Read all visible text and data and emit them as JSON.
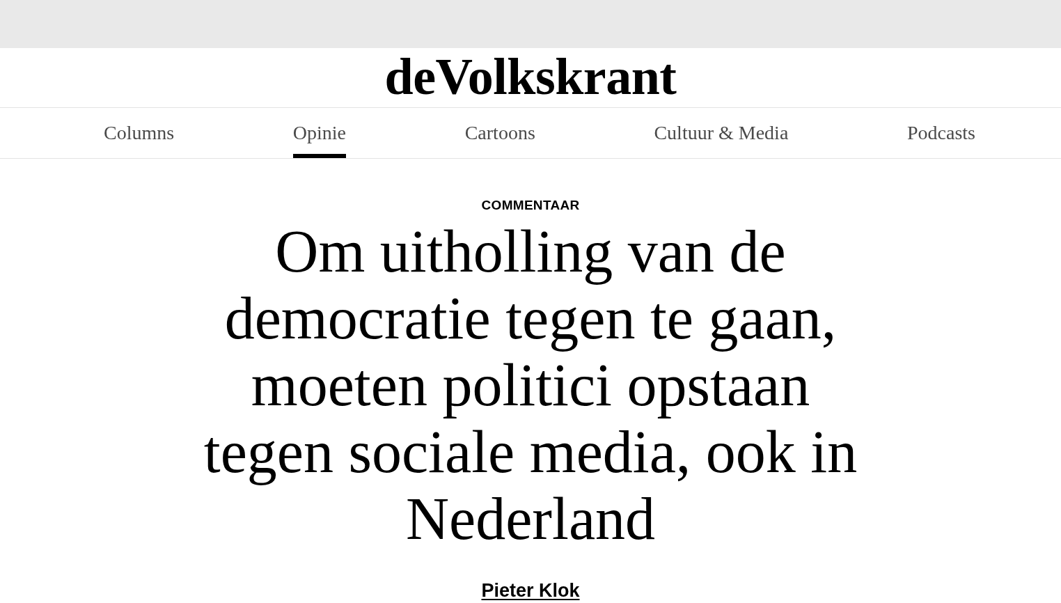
{
  "logo": "deVolkskrant",
  "nav": [
    {
      "label": "Columns",
      "selected": false
    },
    {
      "label": "Opinie",
      "selected": true
    },
    {
      "label": "Cartoons",
      "selected": false
    },
    {
      "label": "Cultuur & Media",
      "selected": false
    },
    {
      "label": "Podcasts",
      "selected": false
    }
  ],
  "article": {
    "category": "COMMENTAAR",
    "title": "Om uitholling van de democratie tegen te gaan, moeten politici opstaan tegen sociale media, ook in Nederland",
    "author": "Pieter Klok"
  }
}
